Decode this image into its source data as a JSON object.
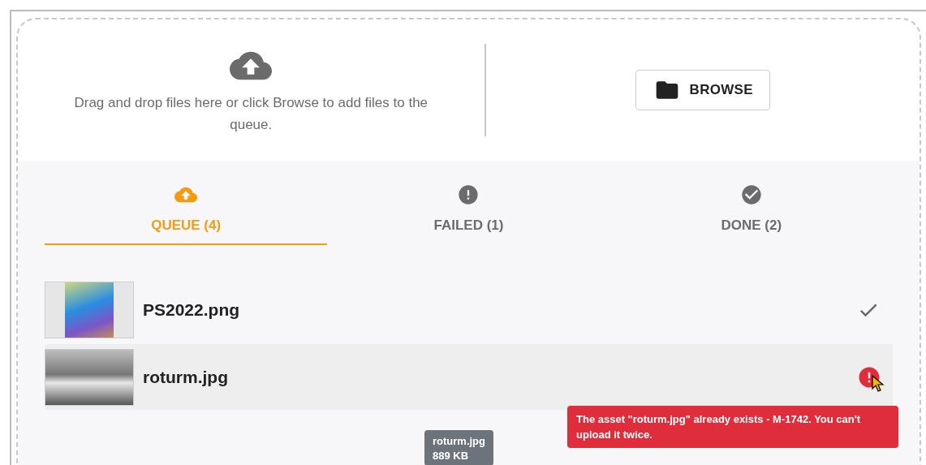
{
  "dropzone": {
    "instructions": "Drag and drop files here or click Browse to add files to the queue.",
    "browse_button": "BROWSE"
  },
  "tabs": [
    {
      "label": "QUEUE (4)",
      "kind": "queue",
      "selected": true
    },
    {
      "label": "FAILED (1)",
      "kind": "failed",
      "selected": false
    },
    {
      "label": "DONE (2)",
      "kind": "done",
      "selected": false
    }
  ],
  "files": [
    {
      "name": "PS2022.png",
      "kind": "done",
      "highlighted": false
    },
    {
      "name": "roturm.jpg",
      "kind": "failed",
      "highlighted": true
    }
  ],
  "error_tooltip": "The asset \"roturm.jpg\" already exists - M-1742. You can't upload it twice.",
  "file_tooltip": {
    "name": "roturm.jpg",
    "size": "889 KB"
  }
}
